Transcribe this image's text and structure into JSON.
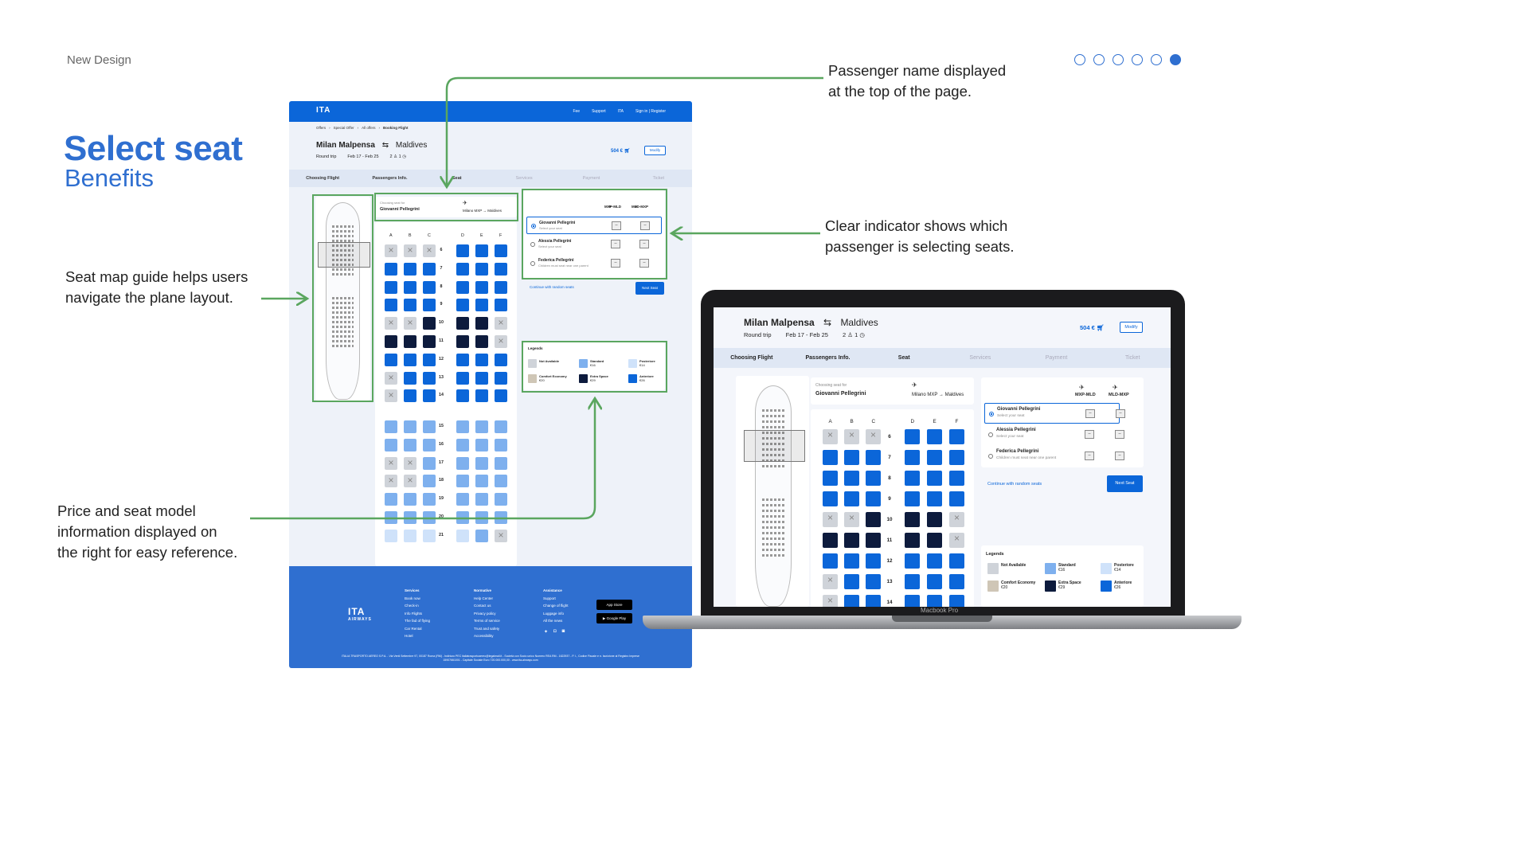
{
  "slide": {
    "label": "New Design",
    "title": "Select seat",
    "subtitle": "Benefits",
    "dots": [
      false,
      false,
      false,
      false,
      false,
      true
    ]
  },
  "annotations": {
    "passenger_name": [
      "Passenger name displayed",
      "at the top of the page."
    ],
    "indicator": [
      "Clear indicator shows which",
      "passenger is selecting seats."
    ],
    "seatmap_guide": [
      "Seat map guide helps users",
      "navigate the plane layout."
    ],
    "price_info": [
      "Price and seat model",
      "information displayed on",
      "the right for easy reference."
    ]
  },
  "colors": {
    "accent": "#2f6fd0",
    "brand": "#0b66d9",
    "arrow": "#5aa65f"
  },
  "app": {
    "logo": "ITA",
    "logo_sub": "AIRWAYS",
    "nav": [
      "Fee",
      "Support",
      "ITA",
      "Sign in | Register"
    ],
    "breadcrumb": [
      "Offers",
      "Special Offer",
      "All offers",
      "Booking Flight"
    ],
    "from": "Milan Malpensa",
    "to": "Maldives",
    "swap_icon": "swap-icon",
    "trip": "Round trip",
    "dates": "Feb 17 - Feb 25",
    "pax_count": "2",
    "bag_count": "1",
    "price": "504 €",
    "modify": "Modify",
    "steps": [
      "Choosing Flight",
      "Passengers Info.",
      "Seat",
      "Services",
      "Payment",
      "Ticket"
    ],
    "choosing_for": "Choosing seat for",
    "current_passenger": "Giovanni Pellegrini",
    "leg_from": "Milano MXP",
    "leg_to": "Maldives",
    "seat_columns": [
      "A",
      "B",
      "C",
      "D",
      "E",
      "F"
    ],
    "legs": [
      "MXP-MLD",
      "MLD-MXP"
    ],
    "passengers": [
      {
        "name": "Giovanni Pellegrini",
        "desc": "Select your seat",
        "selected": true
      },
      {
        "name": "Alessia Pellegrini",
        "desc": "Select your seat",
        "selected": false
      },
      {
        "name": "Federica Pellegrini",
        "desc": "Children must seat near one parent",
        "selected": false
      }
    ],
    "seat_placeholder": "--",
    "random": "Continue with random seats",
    "next": "Next Seat",
    "legend_title": "Legends",
    "legend": [
      {
        "key": "na",
        "name": "Not Available",
        "price": ""
      },
      {
        "key": "std",
        "name": "Standard",
        "price": "€16"
      },
      {
        "key": "post",
        "name": "Posteriore",
        "price": "€14"
      },
      {
        "key": "comfort",
        "name": "Comfort Economy",
        "price": "€20"
      },
      {
        "key": "extra",
        "name": "Extra Space",
        "price": "€29"
      },
      {
        "key": "ant",
        "name": "Anteriore",
        "price": "€26"
      }
    ],
    "rows_front": [
      {
        "n": "6",
        "s": "nnnaaa"
      },
      {
        "n": "7",
        "s": "aaaaaa"
      },
      {
        "n": "8",
        "s": "aaaaaa"
      },
      {
        "n": "9",
        "s": "aaaaaa"
      },
      {
        "n": "10",
        "s": "nnxxxn"
      },
      {
        "n": "11",
        "s": "xxxxxn"
      },
      {
        "n": "12",
        "s": "aaaaaa"
      },
      {
        "n": "13",
        "s": "naaaaa"
      },
      {
        "n": "14",
        "s": "naaaaa"
      }
    ],
    "rows_back": [
      {
        "n": "15",
        "s": "ssssss"
      },
      {
        "n": "16",
        "s": "ssssss"
      },
      {
        "n": "17",
        "s": "nnssss"
      },
      {
        "n": "18",
        "s": "nnssss"
      },
      {
        "n": "19",
        "s": "ssssss"
      },
      {
        "n": "20",
        "s": "ssssss"
      },
      {
        "n": "21",
        "s": "ppppsn"
      }
    ],
    "footer": {
      "col1": [
        "Services",
        "Book now",
        "Check-in",
        "Info Flights",
        "The fad of flying",
        "Car Rental",
        "Hotel"
      ],
      "col2": [
        "Normative",
        "Help Center",
        "Contact us",
        "Privacy policy",
        "Terms of service",
        "Trust and safety",
        "Accessibility"
      ],
      "col3": [
        "Assistance",
        "Support",
        "Change of flight",
        "Luggage info",
        "All the news"
      ],
      "app_store": "App Store",
      "google_play": "Google Play",
      "legal": "ITALIA TRASPORTO AEREO S.P.A. - Via Venti Settembre 97, 00187 Roma (RM) - Indirizzo PEC italiatrasportoaereo@legalmail.it - Società con Socio unico Numero REA RM - 1622937 - P. I., Codice Fiscale e n. Iscrizione al Registro Imprese 15907661001 - Capitale Sociale Euro 720.000.000,00 - www.ita-airways.com"
    }
  },
  "laptop": {
    "label": "Macbook Pro"
  }
}
